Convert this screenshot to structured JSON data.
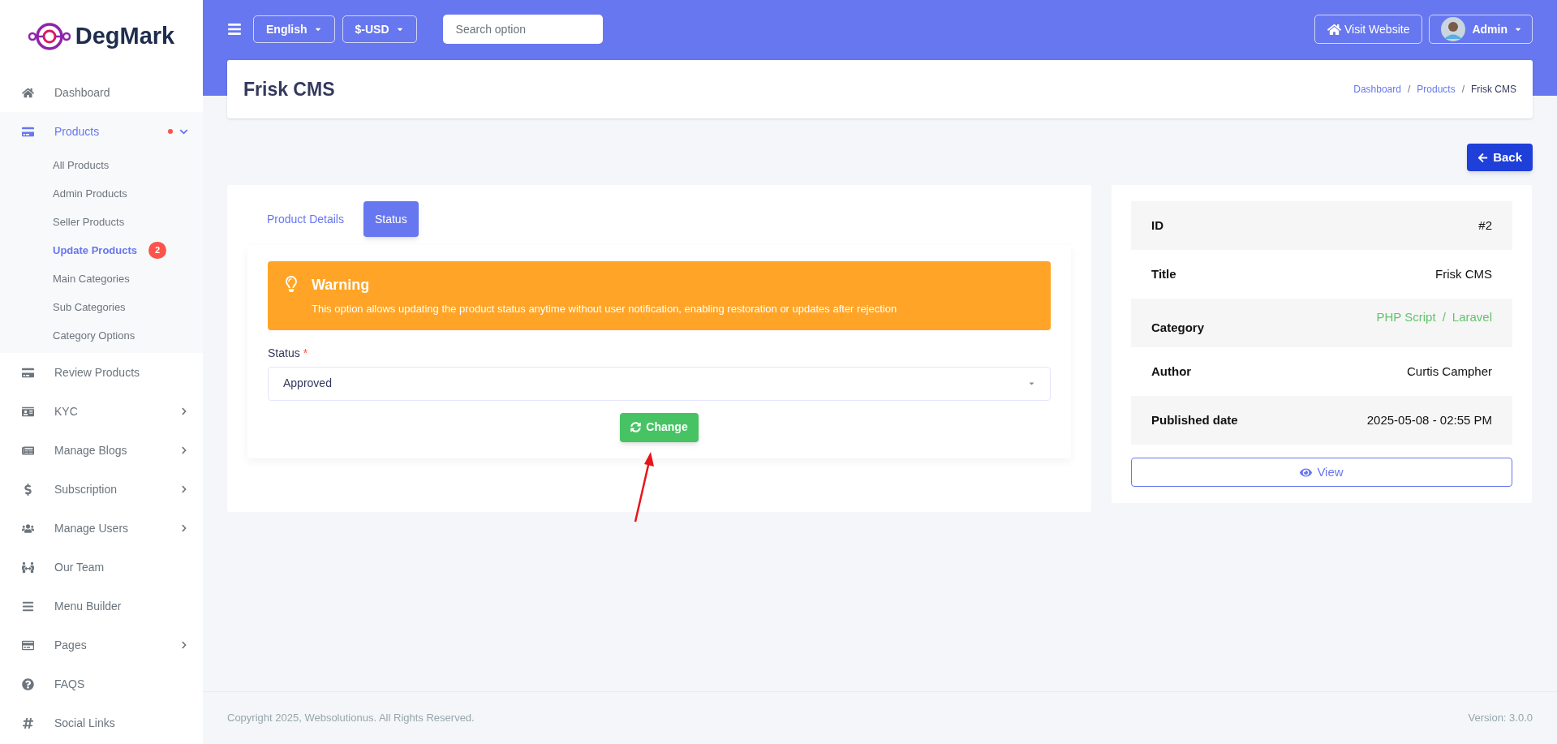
{
  "brand": {
    "name": "DegMark"
  },
  "sidebar": {
    "items": [
      {
        "label": "Dashboard",
        "selected": false,
        "submenu": false,
        "dot": false
      },
      {
        "label": "Products",
        "selected": true,
        "expanded": true,
        "submenu": true,
        "dot": true,
        "children": [
          {
            "label": "All Products",
            "selected": false
          },
          {
            "label": "Admin Products",
            "selected": false
          },
          {
            "label": "Seller Products",
            "selected": false
          },
          {
            "label": "Update Products",
            "selected": true,
            "badge": "2"
          },
          {
            "label": "Main Categories",
            "selected": false
          },
          {
            "label": "Sub Categories",
            "selected": false
          },
          {
            "label": "Category Options",
            "selected": false
          }
        ]
      },
      {
        "label": "Review Products",
        "selected": false,
        "submenu": false,
        "dot": false
      },
      {
        "label": "KYC",
        "selected": false,
        "expanded": false,
        "submenu": true,
        "dot": false
      },
      {
        "label": "Manage Blogs",
        "selected": false,
        "expanded": false,
        "submenu": true,
        "dot": false
      },
      {
        "label": "Subscription",
        "selected": false,
        "expanded": false,
        "submenu": true,
        "dot": false
      },
      {
        "label": "Manage Users",
        "selected": false,
        "expanded": false,
        "submenu": true,
        "dot": false
      },
      {
        "label": "Our Team",
        "selected": false,
        "submenu": false,
        "dot": false
      },
      {
        "label": "Menu Builder",
        "selected": false,
        "submenu": false,
        "dot": false
      },
      {
        "label": "Pages",
        "selected": false,
        "expanded": false,
        "submenu": true,
        "dot": false
      },
      {
        "label": "FAQS",
        "selected": false,
        "submenu": false,
        "dot": false
      },
      {
        "label": "Social Links",
        "selected": false,
        "submenu": false,
        "dot": false
      }
    ]
  },
  "topbar": {
    "language": "English",
    "currency": "$-USD",
    "search": {
      "placeholder": "Search option"
    },
    "visit_website": "Visit Website",
    "user": "Admin"
  },
  "page_header": {
    "title": "Frisk CMS",
    "breadcrumb_separator": "/",
    "breadcrumb": [
      {
        "label": "Dashboard",
        "link": true
      },
      {
        "label": "Products",
        "link": true
      },
      {
        "label": "Frisk CMS",
        "link": false
      }
    ]
  },
  "back_button": "Back",
  "tabs": [
    {
      "label": "Product Details",
      "selected": false
    },
    {
      "label": "Status",
      "selected": true
    }
  ],
  "warning": {
    "title": "Warning",
    "text": "This option allows updating the product status anytime without user notification, enabling restoration or updates after rejection"
  },
  "status_field": {
    "label": "Status",
    "required": true,
    "required_mark": "*",
    "value": "Approved"
  },
  "change_button": "Change",
  "details": [
    {
      "label": "ID",
      "value": "#2"
    },
    {
      "label": "Title",
      "value": "Frisk CMS"
    },
    {
      "label": "Category",
      "separator": "/",
      "links": [
        "PHP Script",
        "Laravel"
      ]
    },
    {
      "label": "Author",
      "value": "Curtis Campher"
    },
    {
      "label": "Published date",
      "value": "2025-05-08 - 02:55 PM"
    }
  ],
  "view_button": "View",
  "footer": {
    "copyright": "Copyright 2025, Websolutionus. All Rights Reserved.",
    "version": "Version: 3.0.0"
  }
}
